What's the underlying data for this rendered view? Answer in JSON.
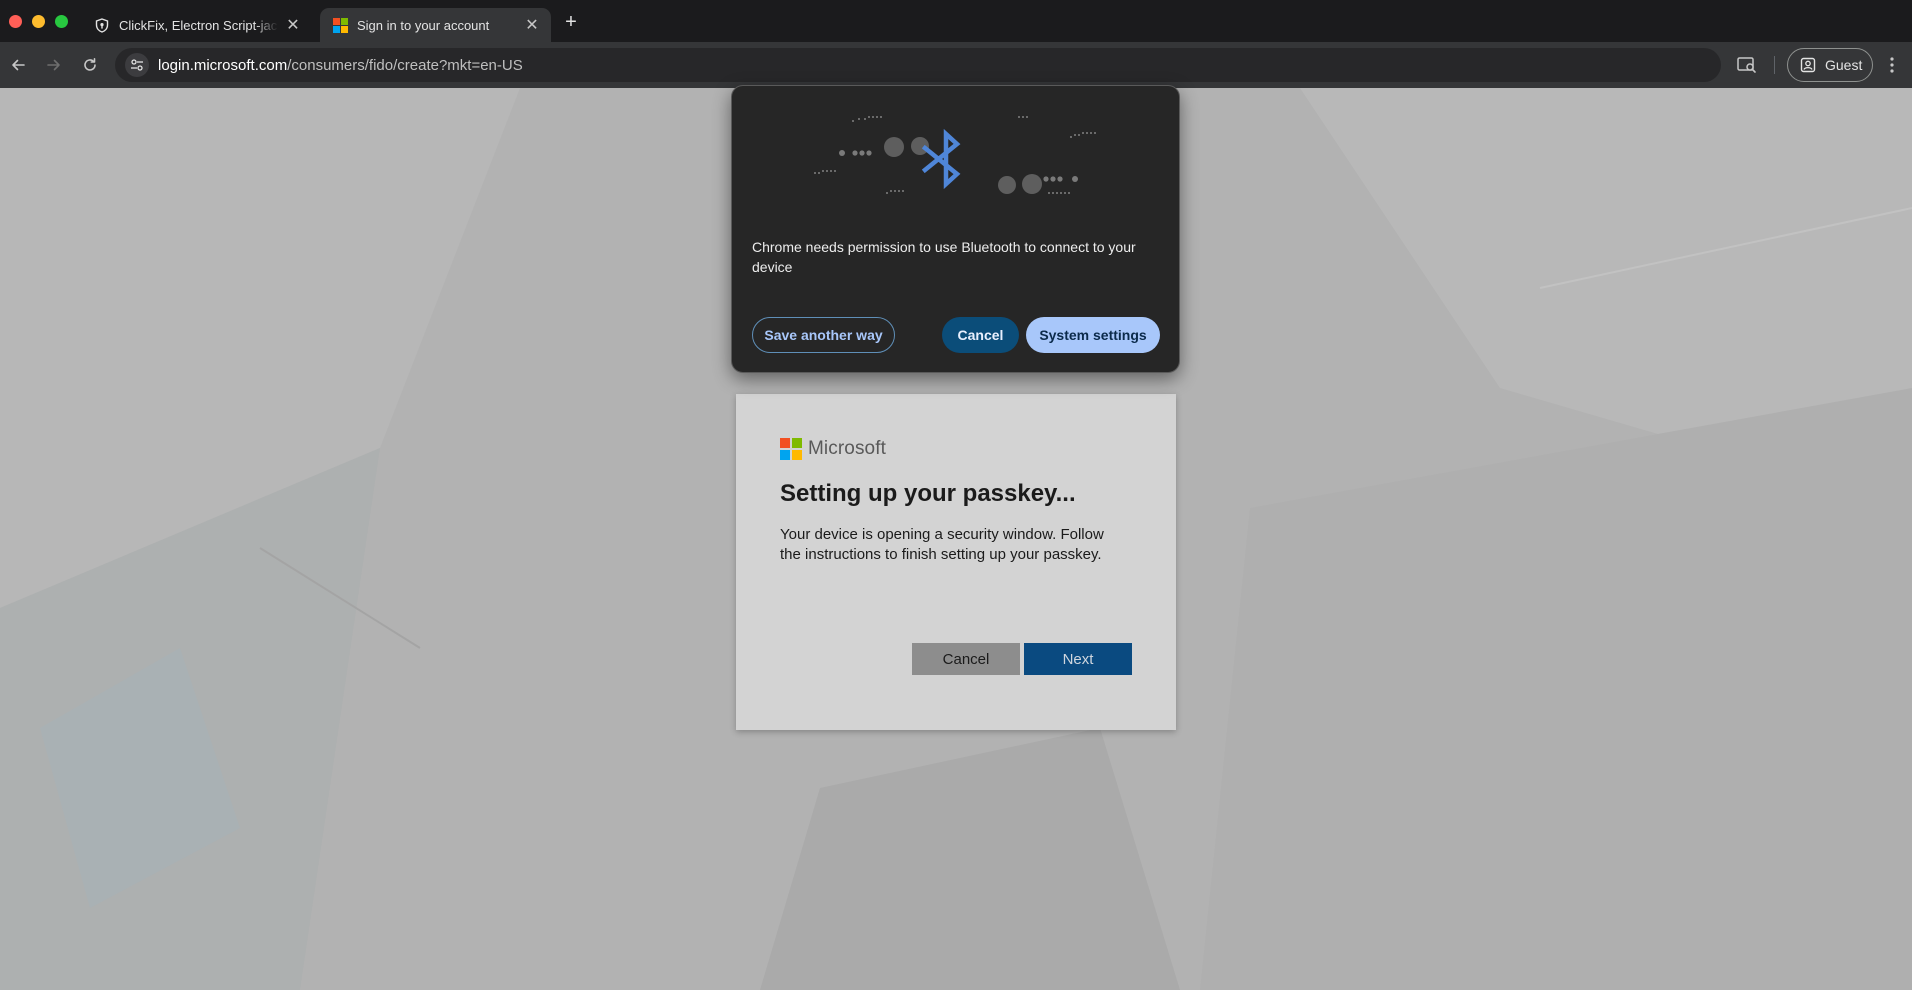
{
  "browser": {
    "tabs": [
      {
        "title": "ClickFix, Electron Script-jacking",
        "favicon": "shield-icon",
        "active": false
      },
      {
        "title": "Sign in to your account",
        "favicon": "microsoft-logo-icon",
        "active": true
      }
    ],
    "url": {
      "host": "login.microsoft.com",
      "path": "/consumers/fido/create?mkt=en-US"
    },
    "profile": {
      "label": "Guest"
    }
  },
  "bluetooth_prompt": {
    "message": "Chrome needs permission to use Bluetooth to connect to your device",
    "buttons": {
      "save_another_way": "Save another way",
      "cancel": "Cancel",
      "system_settings": "System settings"
    },
    "illustration": "bluetooth-icon",
    "colors": {
      "primary": "#a8c7fa",
      "tonal": "#0b4d79",
      "bluetooth": "#4f86d8"
    }
  },
  "signin": {
    "brand": "Microsoft",
    "title": "Setting up your passkey...",
    "body": "Your device is opening a security window. Follow the instructions to finish setting up your passkey.",
    "buttons": {
      "cancel": "Cancel",
      "next": "Next"
    },
    "colors": {
      "next": "#0a4a80",
      "logo": [
        "#f25022",
        "#7fba00",
        "#00a4ef",
        "#ffb900"
      ]
    }
  }
}
